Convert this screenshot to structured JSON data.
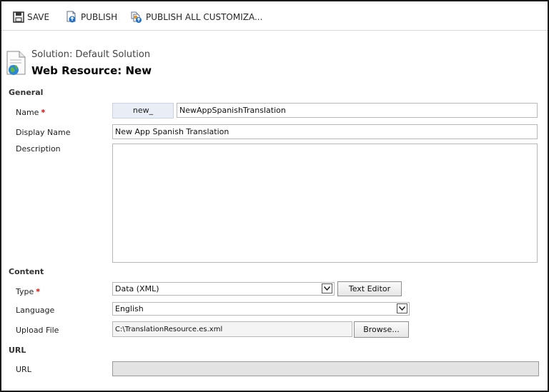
{
  "toolbar": {
    "save_label": "SAVE",
    "publish_label": "PUBLISH",
    "publish_all_label": "PUBLISH ALL CUSTOMIZA..."
  },
  "header": {
    "solution": "Solution: Default Solution",
    "title": "Web Resource: New"
  },
  "general": {
    "section_label": "General",
    "name_label": "Name",
    "name_prefix": "new_",
    "name_value": "NewAppSpanishTranslation",
    "display_name_label": "Display Name",
    "display_name_value": "New App Spanish Translation",
    "description_label": "Description",
    "description_value": ""
  },
  "content": {
    "section_label": "Content",
    "type_label": "Type",
    "type_value": "Data (XML)",
    "text_editor_label": "Text Editor",
    "language_label": "Language",
    "language_value": "English",
    "upload_label": "Upload File",
    "upload_value": "C:\\TranslationResource.es.xml",
    "browse_label": "Browse..."
  },
  "url": {
    "section_label": "URL",
    "url_label": "URL",
    "url_value": ""
  },
  "required_marker": "*",
  "colors": {
    "required": "#e00000",
    "prefix_bg": "#e8edf6"
  }
}
